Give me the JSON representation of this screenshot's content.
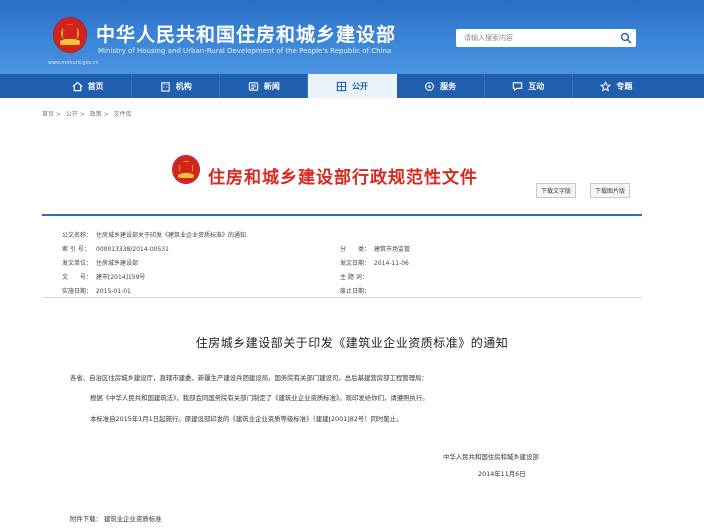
{
  "header": {
    "title": "中华人民共和国住房和城乡建设部",
    "subtitle": "Ministry of Housing and Urban-Rural Development of the People's Republic of China",
    "url": "www.mohurd.gov.cn",
    "search_placeholder": "请输入搜索内容"
  },
  "nav": {
    "items": [
      {
        "label": "首页",
        "icon": "home-icon"
      },
      {
        "label": "机构",
        "icon": "building-icon"
      },
      {
        "label": "新闻",
        "icon": "news-icon"
      },
      {
        "label": "公开",
        "icon": "public-icon"
      },
      {
        "label": "服务",
        "icon": "service-icon"
      },
      {
        "label": "互动",
        "icon": "interact-icon"
      },
      {
        "label": "专题",
        "icon": "topic-icon"
      }
    ],
    "active_index": 3
  },
  "breadcrumb": [
    "首页 >",
    "公开 >",
    "政策 >",
    "文件库"
  ],
  "doc_banner": {
    "title": "住房和城乡建设部行政规范性文件",
    "download_text": "下载文字版",
    "download_image": "下载图片版"
  },
  "meta": {
    "title_label": "公文名称：",
    "title_value": "住房城乡建设部关于印发《建筑业企业资质标准》的通知",
    "index_label": "索 引 号：",
    "index_value": "000013338/2014-00531",
    "category_label": "分　　类：",
    "category_value": "建筑市场监管",
    "issuer_label": "发文单位：",
    "issuer_value": "住房城乡建设部",
    "date_label": "发文日期：",
    "date_value": "2014-11-06",
    "docno_label": "文　　号：",
    "docno_value": "建市[2014]159号",
    "keywords_label": "主 题 词：",
    "keywords_value": "",
    "effective_label": "实施日期：",
    "effective_value": "2015-01-01",
    "expire_label": "废止日期：",
    "expire_value": ""
  },
  "article": {
    "title": "住房城乡建设部关于印发《建筑业企业资质标准》的通知",
    "p1": "各省、自治区住房城乡建设厅，直辖市建委，新疆生产建设兵团建设局，国务院有关部门建设司，总后基建营房部工程管理局：",
    "p2": "根据《中华人民共和国建筑法》，我部会同国务院有关部门制定了《建筑业企业资质标准》。现印发给你们，请遵照执行。",
    "p3": "本标准自2015年1月1日起施行。原建设部印发的《建筑业企业资质等级标准》（建建[2001]82号）同时废止。",
    "signer": "中华人民共和国住房和城乡建设部",
    "sign_date": "2014年11月6日"
  },
  "attachment": {
    "label": "附件下载：",
    "link": "建筑业企业资质标准"
  },
  "colors": {
    "header_blue": "#3c86d8",
    "nav_blue": "#1f5fae",
    "title_red": "#d62a20"
  }
}
